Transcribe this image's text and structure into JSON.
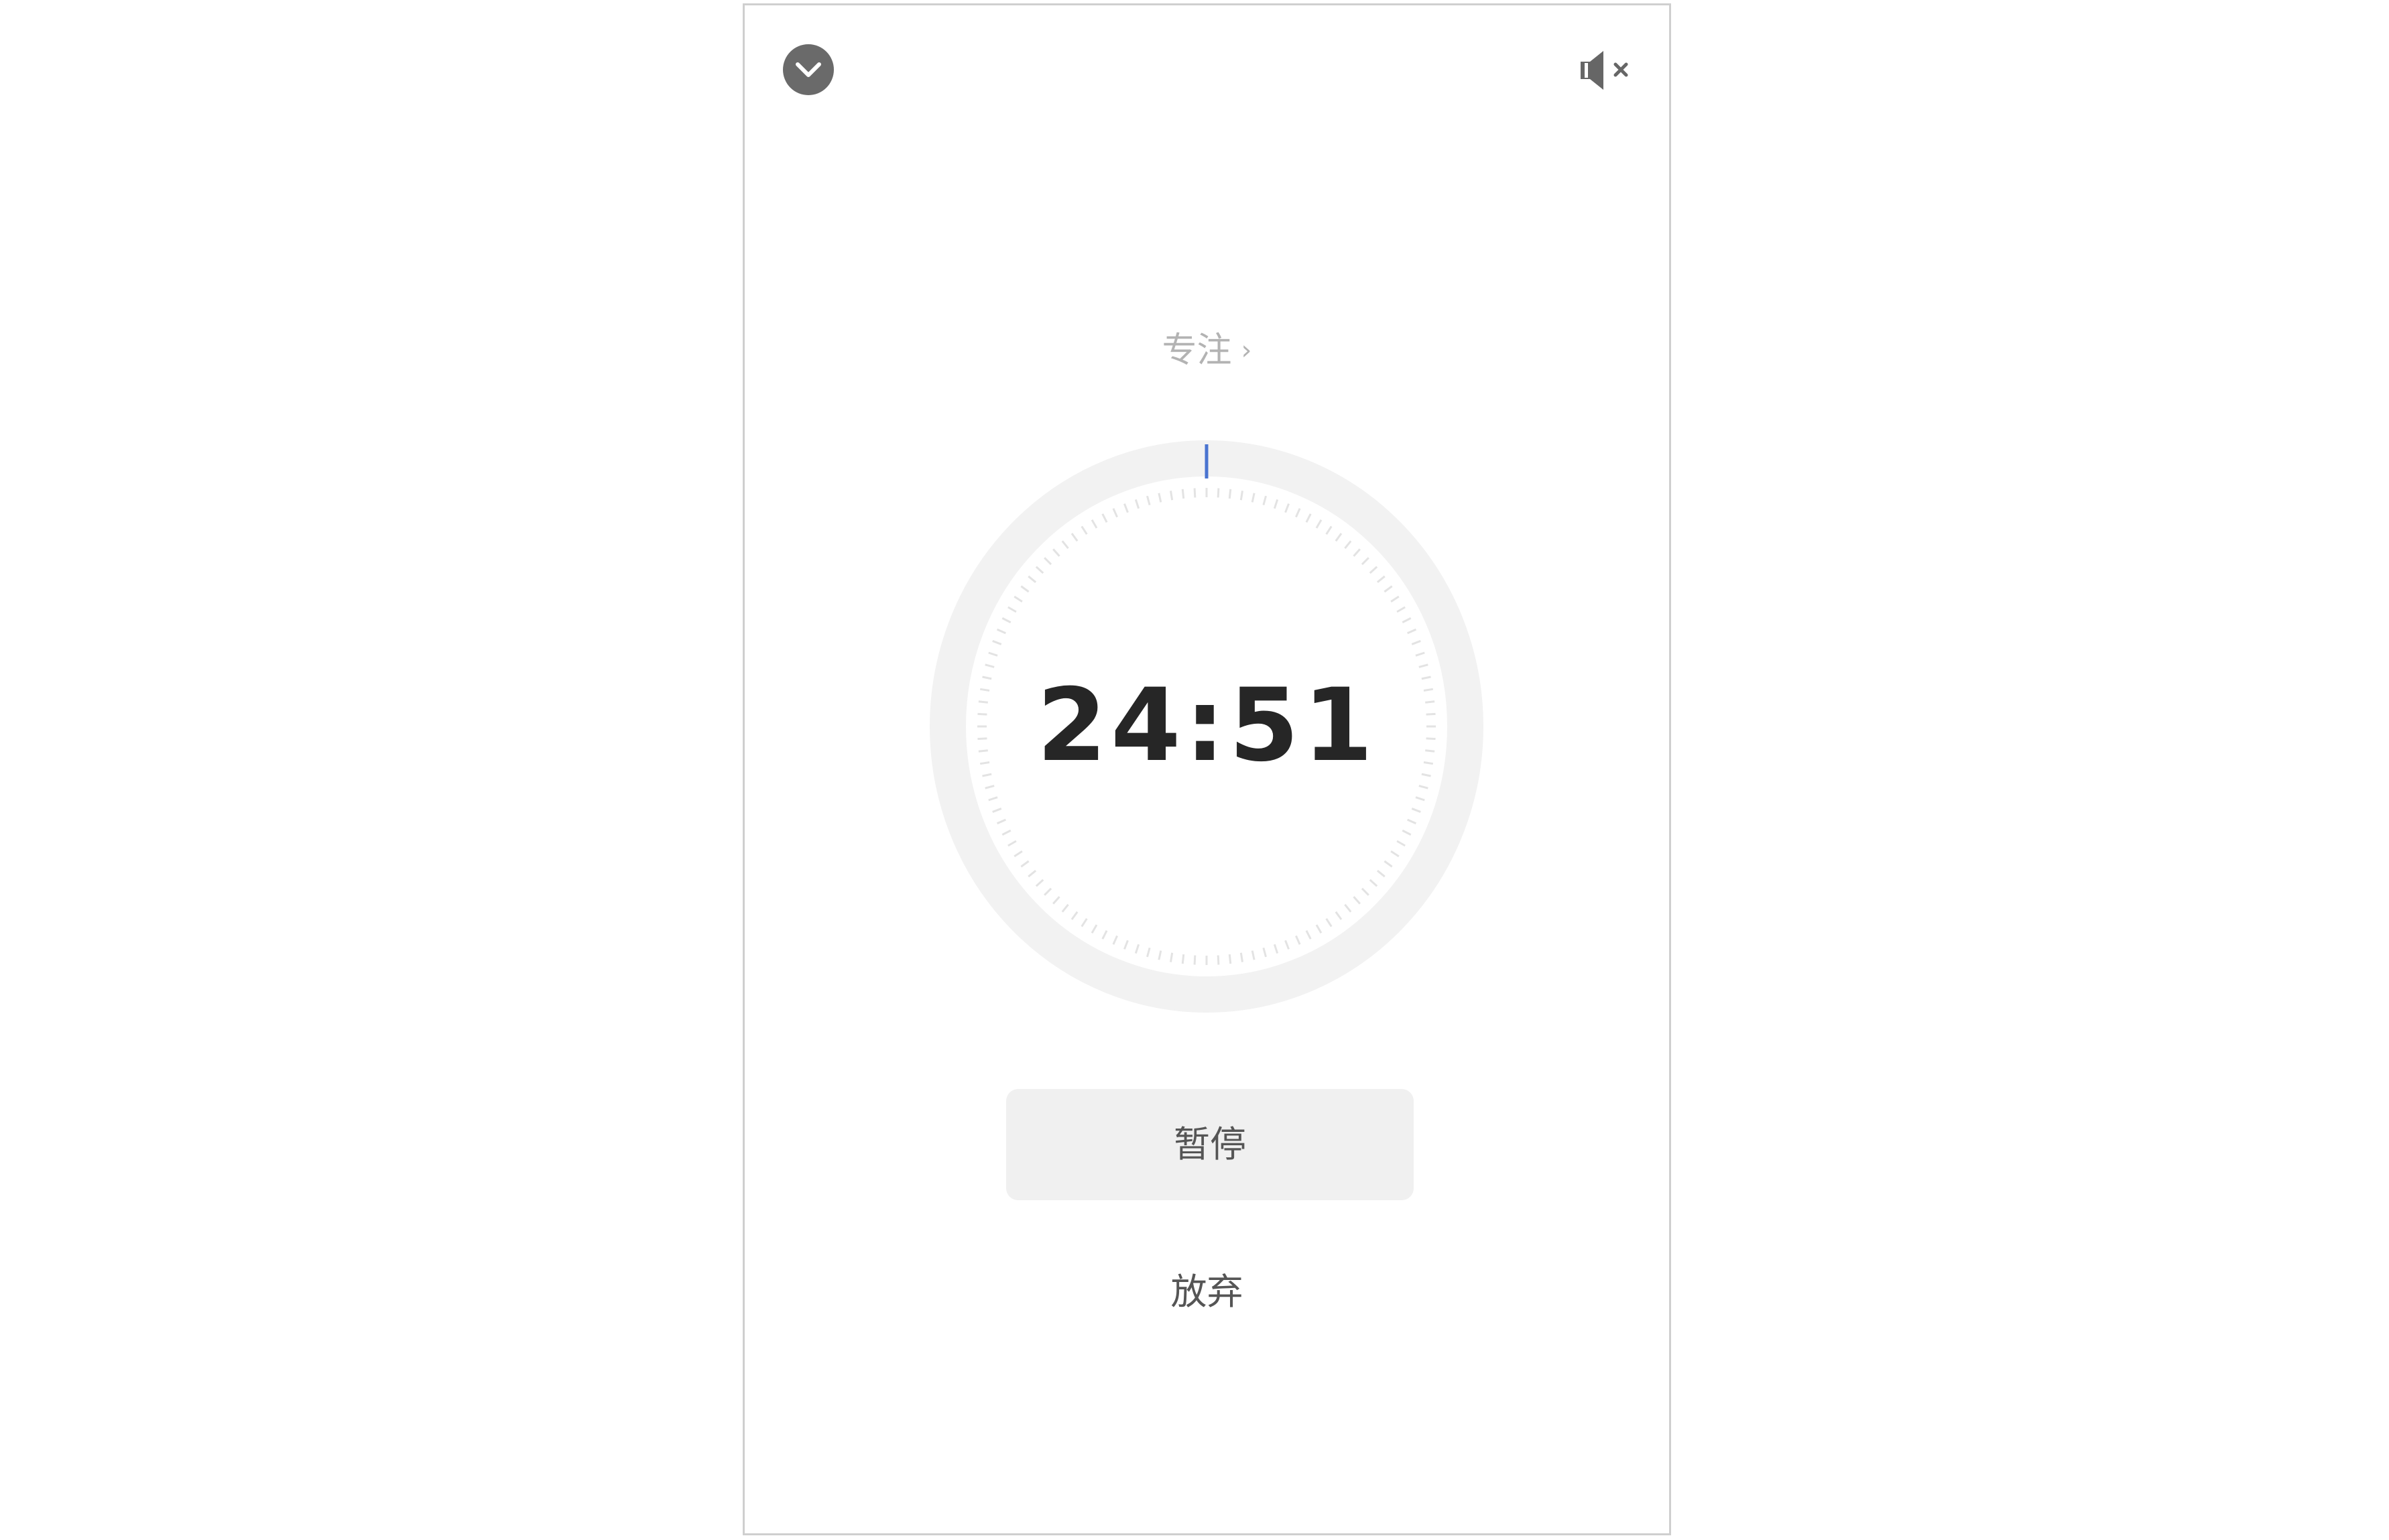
{
  "header": {
    "collapse_icon": "chevron-down-circle-icon",
    "sound_icon": "speaker-muted-icon"
  },
  "timer": {
    "mode_label": "专注",
    "mode_chevron": "›",
    "time": "24:51",
    "progress_color": "#4a74d0",
    "track_color": "#f2f2f2",
    "tick_color": "#e3e3e3"
  },
  "actions": {
    "pause_label": "暂停",
    "abandon_label": "放弃"
  }
}
